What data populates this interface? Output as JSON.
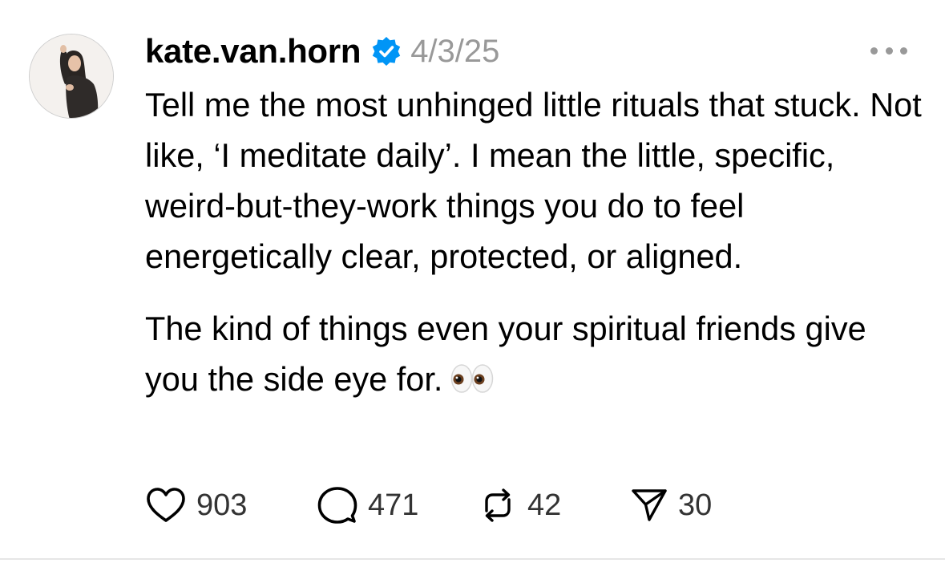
{
  "post": {
    "author": {
      "username": "kate.van.horn",
      "verified": true
    },
    "date": "4/3/25",
    "paragraphs": [
      "Tell me the most unhinged little rituals that stuck. Not like, ‘I meditate daily’. I mean the little, specific, weird-but-they-work things you do to feel energetically clear, protected, or aligned.",
      "The kind of things even your spiritual friends give you the side eye for."
    ],
    "emoji": "eyes-emoji",
    "stats": {
      "likes": "903",
      "replies": "471",
      "reposts": "42",
      "shares": "30"
    }
  },
  "icons": {
    "verified": "verified-badge-icon",
    "more": "more-options-icon",
    "like": "heart-icon",
    "reply": "comment-bubble-icon",
    "repost": "repost-icon",
    "share": "send-icon"
  },
  "colors": {
    "verified_badge": "#0095F6",
    "muted_text": "#999999",
    "stat_text": "#333333",
    "divider": "#E6E6E6"
  }
}
